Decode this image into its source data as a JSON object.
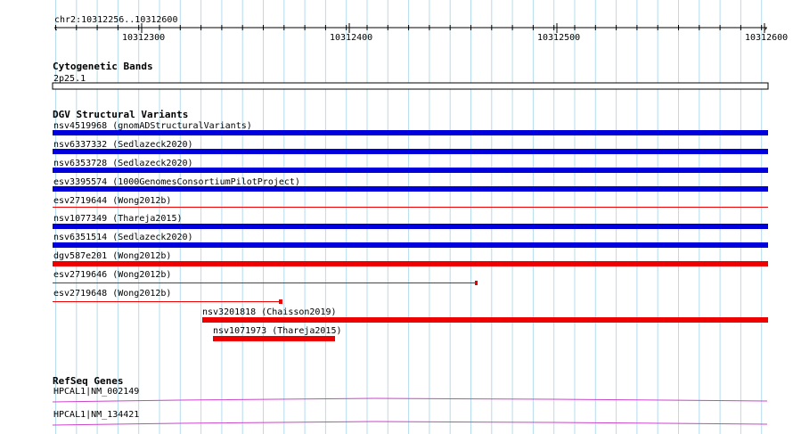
{
  "colors": {
    "grid": "#b4dcee",
    "dgv_blue": "#0000dd",
    "dgv_red": "#ee0000",
    "refseq": "#cc44cc",
    "ink": "#000000"
  },
  "ruler": {
    "location": "chr2:10312256..10312600",
    "ticks": [
      "10312300",
      "10312400",
      "10312500",
      "10312600"
    ]
  },
  "cytoband": {
    "title": "Cytogenetic Bands",
    "band": "2p25.1"
  },
  "dgv": {
    "title": "DGV Structural Variants",
    "features": [
      {
        "label": "nsv4519968 (gnomADStructuralVariants)",
        "color": "blue",
        "thickness": "thick",
        "span": "full"
      },
      {
        "label": "nsv6337332 (Sedlazeck2020)",
        "color": "blue",
        "thickness": "thick",
        "span": "full"
      },
      {
        "label": "nsv6353728 (Sedlazeck2020)",
        "color": "blue",
        "thickness": "thick",
        "span": "full"
      },
      {
        "label": "esv3395574 (1000GenomesConsortiumPilotProject)",
        "color": "blue",
        "thickness": "thick",
        "span": "full"
      },
      {
        "label": "esv2719644 (Wong2012b)",
        "color": "red",
        "thickness": "thin",
        "span": "full"
      },
      {
        "label": "nsv1077349 (Thareja2015)",
        "color": "blue",
        "thickness": "thick",
        "span": "full"
      },
      {
        "label": "nsv6351514 (Sedlazeck2020)",
        "color": "blue",
        "thickness": "thick",
        "span": "full"
      },
      {
        "label": "dgv587e201 (Wong2012b)",
        "color": "red",
        "thickness": "thick",
        "span": "full"
      },
      {
        "label": "esv2719646 (Wong2012b)",
        "color": "red",
        "thickness": "thin",
        "span": "ends-10312461"
      },
      {
        "label": "esv2719648 (Wong2012b)",
        "color": "red",
        "thickness": "thin",
        "span": "ends-10312367"
      },
      {
        "label": "nsv3201818 (Chaisson2019)",
        "color": "red",
        "thickness": "thick",
        "span": "starts-10312329"
      },
      {
        "label": "nsv1071973 (Thareja2015)",
        "color": "red",
        "thickness": "thick",
        "span": "10312334-10312390"
      }
    ]
  },
  "refseq": {
    "title": "RefSeq Genes",
    "genes": [
      {
        "label": "HPCAL1|NM_002149"
      },
      {
        "label": "HPCAL1|NM_134421"
      }
    ]
  }
}
